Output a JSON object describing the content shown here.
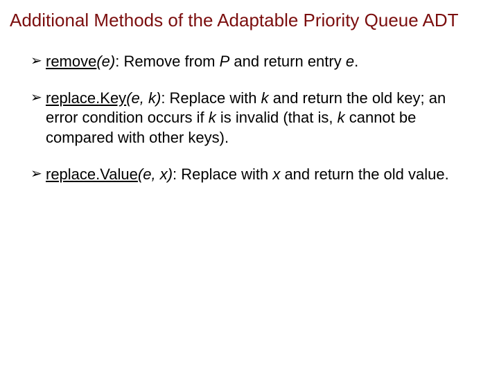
{
  "title": "Additional Methods of the Adaptable Priority Queue ADT",
  "bullets": {
    "marker": "➢",
    "items": [
      {
        "name_u": "remove",
        "args_i": "(e)",
        "sep": ": Remove from ",
        "P_i": "P",
        "mid": " and return entry ",
        "e_i": "e",
        "end": "."
      },
      {
        "name_u": "replace.Key",
        "args_i": "(e, k)",
        "sep": ": Replace with ",
        "k1_i": "k",
        "mid1": " and return the old key; an error condition occurs if ",
        "k2_i": "k",
        "mid2": " is invalid (that is, ",
        "k3_i": "k",
        "mid3": " cannot be compared with other keys).",
        "end": ""
      },
      {
        "name_u": "replace.Value",
        "args_i": "(e, x)",
        "sep": ": Replace with ",
        "x_i": "x",
        "mid": " and return the old value.",
        "end": ""
      }
    ]
  }
}
